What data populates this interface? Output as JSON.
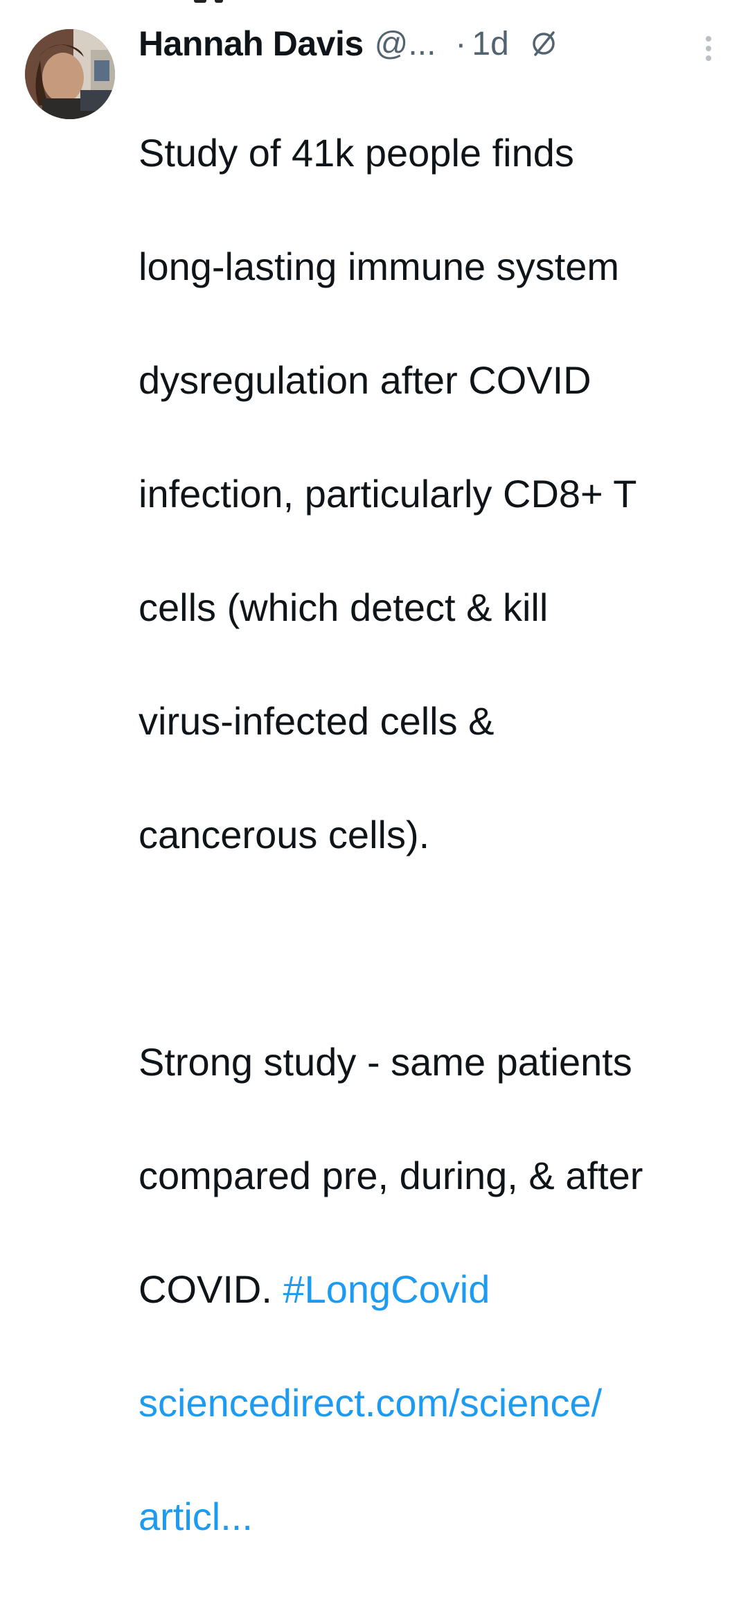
{
  "tweet": {
    "author_name": "Hannah Davis",
    "handle": "@...",
    "separator": "·",
    "time": "1d",
    "paragraph1_lines": [
      "Study of 41k people finds",
      "long-lasting immune system",
      "dysregulation after COVID",
      "infection, particularly CD8+ T",
      "cells (which detect & kill",
      "virus-infected cells &",
      "cancerous cells)."
    ],
    "paragraph2_line1": "Strong study - same patients",
    "paragraph2_line2": "compared pre, during, & after",
    "paragraph2_line3_text": "COVID. ",
    "hashtag": "#LongCovid",
    "link_line1": "sciencedirect.com/science/",
    "link_line2": "articl..."
  },
  "icons": {
    "edit": "edited-circle-slash-icon",
    "more": "more-vertical-icon",
    "avatar": "profile-photo-avatar"
  },
  "colors": {
    "text": "#0f1419",
    "secondary": "#536471",
    "link": "#1d9bf0"
  }
}
